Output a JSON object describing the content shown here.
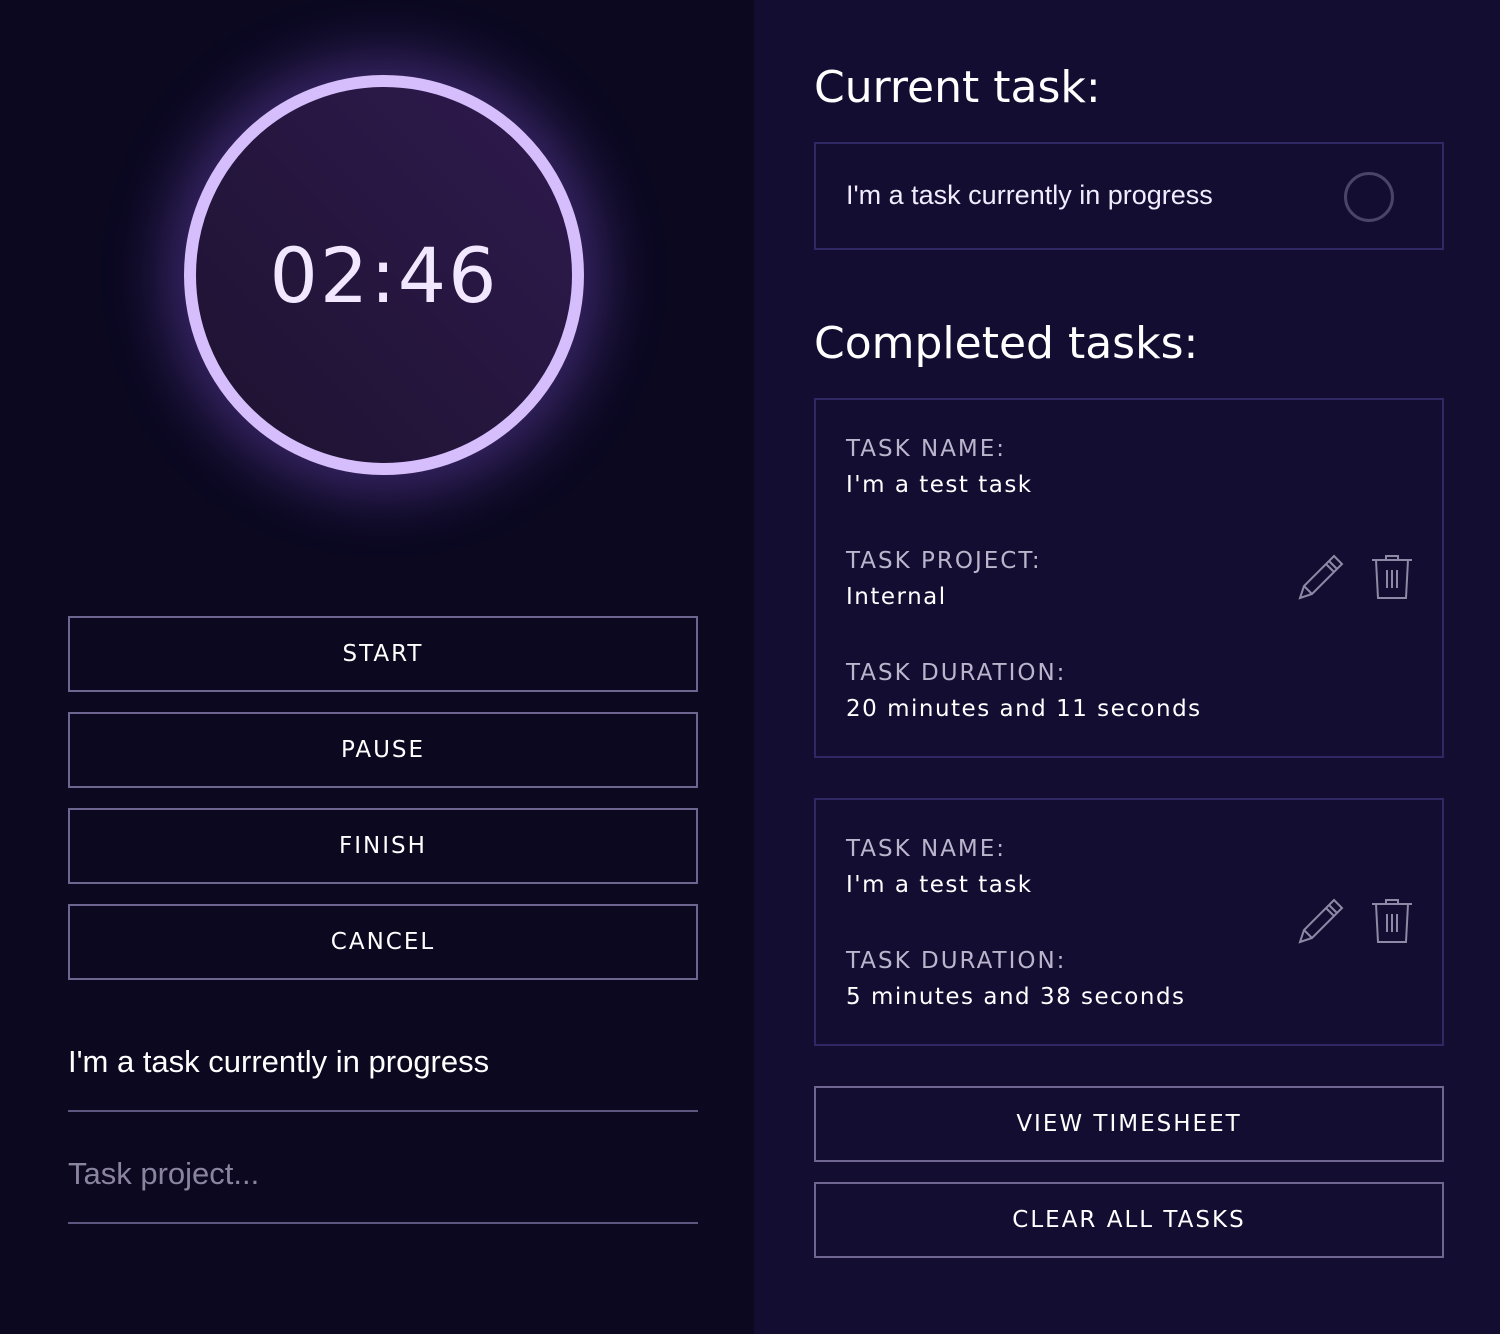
{
  "timer": {
    "display": "02:46"
  },
  "controls": {
    "start": "START",
    "pause": "PAUSE",
    "finish": "FINISH",
    "cancel": "CANCEL"
  },
  "form": {
    "task_name_value": "I'm a task currently in progress",
    "task_project_placeholder": "Task project..."
  },
  "current": {
    "heading": "Current task:",
    "task": "I'm a task currently in progress"
  },
  "completed": {
    "heading": "Completed tasks:",
    "tasks": [
      {
        "name_label": "TASK NAME:",
        "name": "I'm a test task",
        "project_label": "TASK PROJECT:",
        "project": "Internal",
        "duration_label": "TASK DURATION:",
        "duration": "20 minutes and 11 seconds"
      },
      {
        "name_label": "TASK NAME:",
        "name": "I'm a test task",
        "duration_label": "TASK DURATION:",
        "duration": "5 minutes and 38 seconds"
      }
    ]
  },
  "actions": {
    "view_timesheet": "VIEW TIMESHEET",
    "clear_all": "CLEAR ALL TASKS"
  },
  "colors": {
    "accent": "#d6bdfc",
    "left_bg": "#0b0820",
    "right_bg": "#130d32"
  }
}
